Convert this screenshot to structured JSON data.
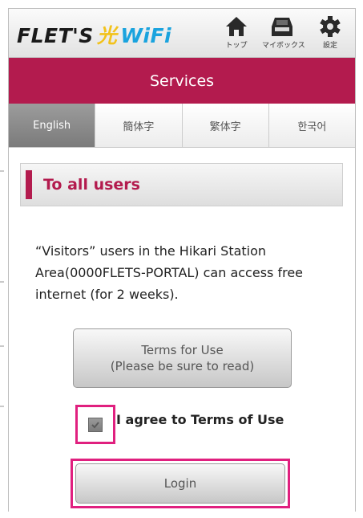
{
  "header": {
    "logo": {
      "part1": "FLET'S",
      "part2": "光",
      "part3": "WiFi"
    },
    "nav": [
      {
        "label": "トップ",
        "icon": "home-icon"
      },
      {
        "label": "マイボックス",
        "icon": "mybox-icon"
      },
      {
        "label": "設定",
        "icon": "gear-icon"
      }
    ]
  },
  "title": "Services",
  "tabs": [
    {
      "label": "English",
      "active": true
    },
    {
      "label": "簡体字",
      "active": false
    },
    {
      "label": "繁体字",
      "active": false
    },
    {
      "label": "한국어",
      "active": false
    }
  ],
  "section": {
    "title": "To all users"
  },
  "info": {
    "line1": "“Visitors” users in the Hikari Station",
    "line2": "Area(0000FLETS-PORTAL) can access free",
    "line3": "internet (for 2 weeks)."
  },
  "terms_button": {
    "line1": "Terms for Use",
    "line2": "(Please be sure to read)"
  },
  "agree": {
    "label": "I agree to Terms of Use",
    "checked": true
  },
  "login_button": {
    "label": "Login"
  },
  "colors": {
    "brand": "#b31b4e",
    "highlight": "#e0207f",
    "active_tab": "#8a8a8a"
  }
}
